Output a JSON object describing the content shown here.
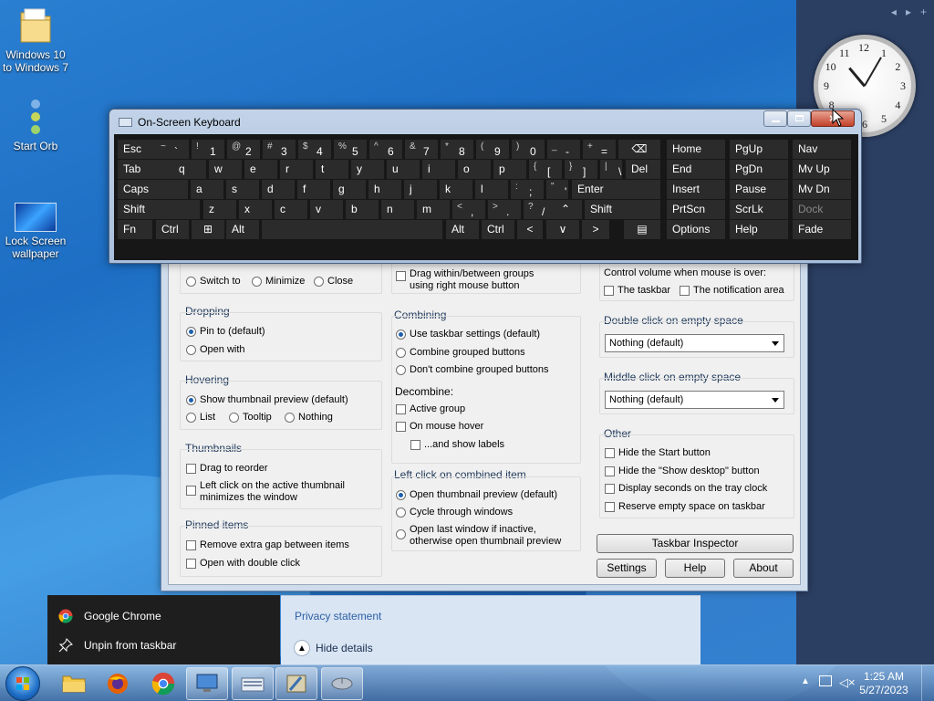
{
  "desktop": {
    "icons": [
      {
        "label": "Windows 10\nto Windows 7"
      },
      {
        "label": "Start Orb"
      },
      {
        "label": "Lock Screen\nwallpaper"
      }
    ]
  },
  "gadget_bar": {
    "prev": "◂",
    "next": "▸",
    "add": "+"
  },
  "clock_numbers": [
    "12",
    "1",
    "2",
    "3",
    "4",
    "5",
    "6",
    "7",
    "8",
    "9",
    "10",
    "11"
  ],
  "osk": {
    "title": "On-Screen Keyboard",
    "rows": {
      "r1": [
        {
          "label": "Esc"
        },
        {
          "s": "~",
          "l": "`"
        },
        {
          "s": "!",
          "l": "1"
        },
        {
          "s": "@",
          "l": "2"
        },
        {
          "s": "#",
          "l": "3"
        },
        {
          "s": "$",
          "l": "4"
        },
        {
          "s": "%",
          "l": "5"
        },
        {
          "s": "^",
          "l": "6"
        },
        {
          "s": "&",
          "l": "7"
        },
        {
          "s": "*",
          "l": "8"
        },
        {
          "s": "(",
          "l": "9"
        },
        {
          "s": ")",
          "l": "0"
        },
        {
          "s": "_",
          "l": "-"
        },
        {
          "s": "+",
          "l": "="
        },
        {
          "label": "⌫"
        }
      ],
      "r2": [
        {
          "label": "Tab"
        },
        {
          "label": "q"
        },
        {
          "label": "w"
        },
        {
          "label": "e"
        },
        {
          "label": "r"
        },
        {
          "label": "t"
        },
        {
          "label": "y"
        },
        {
          "label": "u"
        },
        {
          "label": "i"
        },
        {
          "label": "o"
        },
        {
          "label": "p"
        },
        {
          "s": "{",
          "l": "["
        },
        {
          "s": "}",
          "l": "]"
        },
        {
          "s": "|",
          "l": "\\"
        },
        {
          "label": "Del"
        }
      ],
      "r3": [
        {
          "label": "Caps"
        },
        {
          "label": "a"
        },
        {
          "label": "s"
        },
        {
          "label": "d"
        },
        {
          "label": "f"
        },
        {
          "label": "g"
        },
        {
          "label": "h"
        },
        {
          "label": "j"
        },
        {
          "label": "k"
        },
        {
          "label": "l"
        },
        {
          "s": ":",
          "l": ";"
        },
        {
          "s": "\"",
          "l": "'"
        },
        {
          "label": "Enter"
        }
      ],
      "r4": [
        {
          "label": "Shift"
        },
        {
          "label": "z"
        },
        {
          "label": "x"
        },
        {
          "label": "c"
        },
        {
          "label": "v"
        },
        {
          "label": "b"
        },
        {
          "label": "n"
        },
        {
          "label": "m"
        },
        {
          "s": "<",
          "l": ","
        },
        {
          "s": ">",
          "l": "."
        },
        {
          "s": "?",
          "l": "/"
        },
        {
          "label": "⌃"
        },
        {
          "label": "Shift"
        }
      ],
      "r5": [
        {
          "label": "Fn"
        },
        {
          "label": "Ctrl"
        },
        {
          "label": "⊞"
        },
        {
          "label": "Alt"
        },
        {
          "label": ""
        },
        {
          "label": "Alt"
        },
        {
          "label": "Ctrl"
        },
        {
          "label": "<"
        },
        {
          "label": "∨"
        },
        {
          "label": ">"
        },
        {
          "label": "▤"
        }
      ]
    },
    "nav": [
      [
        "Home",
        "PgUp",
        "Nav"
      ],
      [
        "End",
        "PgDn",
        "Mv Up"
      ],
      [
        "Insert",
        "Pause",
        "Mv Dn"
      ],
      [
        "PrtScn",
        "ScrLk",
        "Dock"
      ],
      [
        "Options",
        "Help",
        "Fade"
      ]
    ]
  },
  "settings": {
    "col1": {
      "cut_row": [
        "Switch to",
        "Minimize",
        "Close"
      ],
      "dropping": {
        "title": "Dropping",
        "opts": [
          "Pin to (default)",
          "Open with"
        ]
      },
      "hovering": {
        "title": "Hovering",
        "opt1": "Show thumbnail preview (default)",
        "opts": [
          "List",
          "Tooltip",
          "Nothing"
        ]
      },
      "thumbnails": {
        "title": "Thumbnails",
        "opt1": "Drag to reorder",
        "opt2": "Left click on the active thumbnail\nminimizes the window"
      },
      "pinned": {
        "title": "Pinned items",
        "opts": [
          "Remove extra gap between items",
          "Open with double click"
        ]
      }
    },
    "col2": {
      "drag_opt": "Drag within/between groups\nusing right mouse button",
      "combining": {
        "title": "Combining",
        "opts": [
          "Use taskbar settings (default)",
          "Combine grouped buttons",
          "Don't combine grouped buttons"
        ]
      },
      "decombine": {
        "title": "Decombine:",
        "opts": [
          "Active group",
          "On mouse hover",
          "...and show labels"
        ]
      },
      "leftclick": {
        "title": "Left click on combined item",
        "opts": [
          "Open thumbnail preview (default)",
          "Cycle through windows",
          "Open last window if inactive,\notherwise open thumbnail preview"
        ]
      }
    },
    "col3": {
      "volume_title": "Control volume when mouse is over:",
      "volume_opts": [
        "The taskbar",
        "The notification area"
      ],
      "dbl_title": "Double click on empty space",
      "dbl_value": "Nothing (default)",
      "mid_title": "Middle click on empty space",
      "mid_value": "Nothing (default)",
      "other": {
        "title": "Other",
        "opts": [
          "Hide the Start button",
          "Hide the \"Show desktop\" button",
          "Display seconds on the tray clock",
          "Reserve empty space on taskbar"
        ]
      },
      "inspector": "Taskbar Inspector",
      "buttons": [
        "Settings",
        "Help",
        "About"
      ]
    }
  },
  "jumplist": {
    "items": [
      "Google Chrome",
      "Unpin from taskbar"
    ]
  },
  "notification": {
    "privacy": "Privacy statement",
    "hide": "Hide details"
  },
  "tray": {
    "time": "1:25 AM",
    "date": "5/27/2023"
  }
}
